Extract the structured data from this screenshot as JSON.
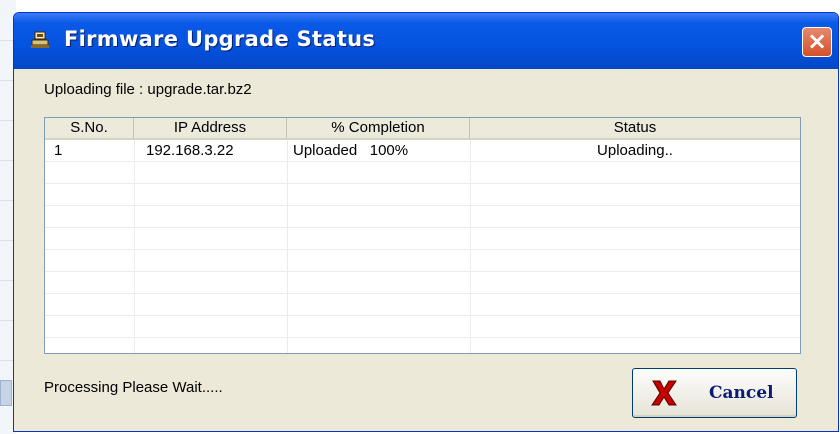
{
  "window": {
    "title": "Firmware Upgrade Status",
    "close_symbol": "×"
  },
  "upload": {
    "label": "Uploading file : upgrade.tar.bz2"
  },
  "table": {
    "columns": [
      "S.No.",
      "IP Address",
      "% Completion",
      "Status"
    ],
    "rows": [
      {
        "sno": "1",
        "ip": "192.168.3.22",
        "completion": "Uploaded   100%",
        "status": "Uploading.."
      }
    ]
  },
  "footer": {
    "status_text": "Processing Please Wait.....",
    "cancel_label": "Cancel"
  },
  "icons": {
    "title_icon": "network-device-icon",
    "close_icon": "close-icon",
    "cancel_icon": "red-x-icon"
  },
  "colors": {
    "titlebar": "#0452de",
    "close_button": "#d4512a",
    "dialog_bg": "#ece9d8",
    "cancel_x": "#c40000"
  }
}
